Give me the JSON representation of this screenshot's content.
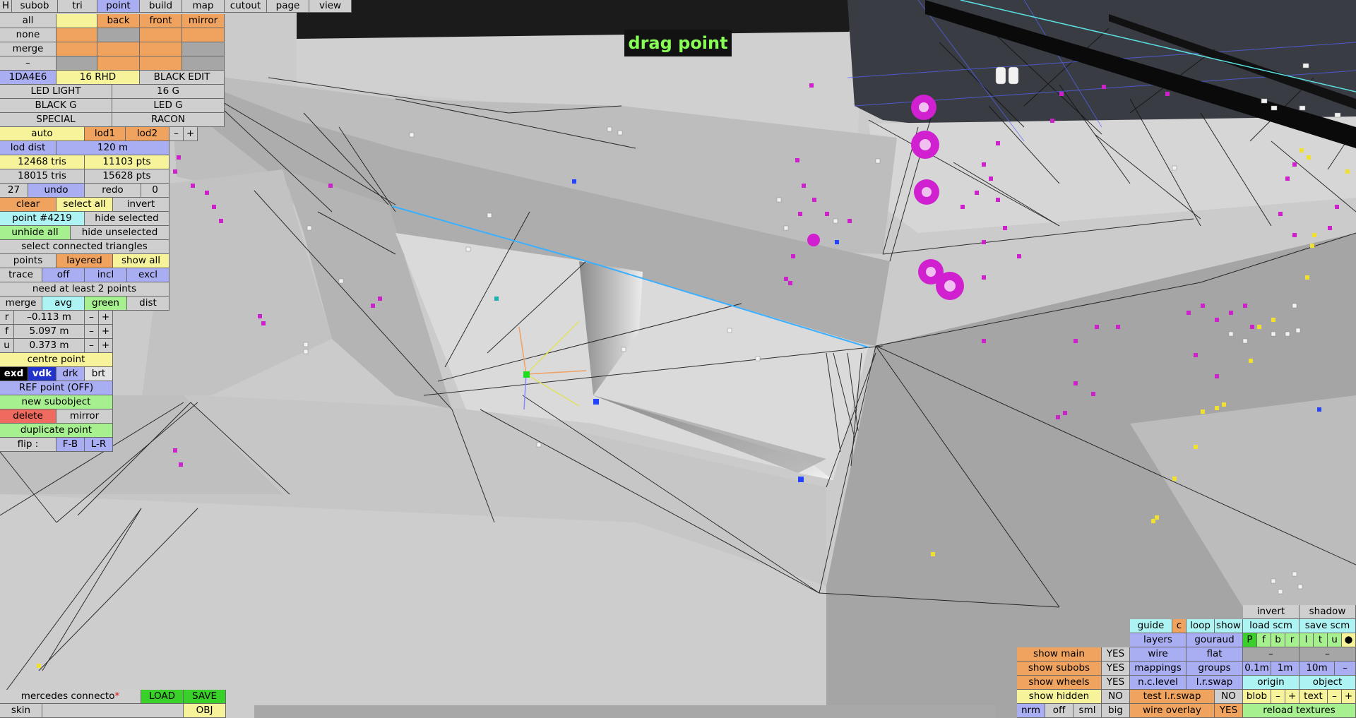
{
  "top_menu": [
    "H",
    "subob",
    "tri",
    "point",
    "build",
    "map",
    "cutout",
    "page",
    "view"
  ],
  "active_tab": "point",
  "overlay_label": "drag point",
  "selection_rows": {
    "all": {
      "label": "all",
      "cols": [
        "",
        "back",
        "front",
        "mirror"
      ]
    },
    "none": {
      "label": "none"
    },
    "merge": {
      "label": "merge"
    },
    "dash": {
      "label": "–"
    }
  },
  "variants": {
    "row1": [
      "1DA4E6",
      "16 RHD",
      "BLACK EDIT"
    ],
    "row2": [
      "LED LIGHT",
      "16 G"
    ],
    "row3": [
      "BLACK G",
      "LED G"
    ],
    "row4": [
      "SPECIAL",
      "RACON"
    ]
  },
  "lod": {
    "auto": "auto",
    "lod1": "lod1",
    "lod2": "lod2",
    "minus": "–",
    "plus": "+",
    "dist_label": "lod dist",
    "dist_value": "120 m",
    "tris1": "12468 tris",
    "pts1": "11103 pts",
    "tris2": "18015 tris",
    "pts2": "15628 pts"
  },
  "history": {
    "count": "27",
    "undo": "undo",
    "redo": "redo",
    "redo_count": "0"
  },
  "selection_tools": {
    "clear": "clear",
    "select_all": "select all",
    "invert": "invert",
    "point_id": "point #4219",
    "hide_selected": "hide selected",
    "unhide_all": "unhide all",
    "hide_unselected": "hide unselected",
    "select_connected": "select connected triangles",
    "points": "points",
    "layered": "layered",
    "show_all": "show all",
    "trace": "trace",
    "off": "off",
    "incl": "incl",
    "excl": "excl",
    "need_points": "need at least 2 points",
    "merge": "merge",
    "avg": "avg",
    "green": "green",
    "dist": "dist"
  },
  "coords": [
    {
      "axis": "r",
      "value": "–0.113 m",
      "minus": "–",
      "plus": "+"
    },
    {
      "axis": "f",
      "value": "5.097 m",
      "minus": "–",
      "plus": "+"
    },
    {
      "axis": "u",
      "value": "0.373 m",
      "minus": "–",
      "plus": "+"
    }
  ],
  "point_tools": {
    "centre_point": "centre point",
    "modes": [
      "exd",
      "vdk",
      "drk",
      "brt"
    ],
    "ref_point": "REF point (OFF)",
    "new_subobject": "new subobject",
    "delete": "delete",
    "mirror": "mirror",
    "duplicate_point": "duplicate point",
    "flip_label": "flip :",
    "flip_fb": "F-B",
    "flip_lr": "L-R"
  },
  "file": {
    "name": "mercedes connecto",
    "modified_mark": "*",
    "load": "LOAD",
    "save": "SAVE",
    "skin": "skin",
    "skin_value": "",
    "obj": "OBJ"
  },
  "bottom_right": {
    "invert": "invert",
    "shadow": "shadow",
    "guide": "guide",
    "c": "c",
    "loop": "loop",
    "show": "show",
    "load_scm": "load scm",
    "save_scm": "save scm",
    "layers": "layers",
    "gouraud": "gouraud",
    "letters": [
      "P",
      "f",
      "b",
      "r",
      "l",
      "t",
      "u",
      "●"
    ],
    "wire": "wire",
    "flat": "flat",
    "dash1": "–",
    "dash2": "–",
    "mappings": "mappings",
    "groups": "groups",
    "steps": [
      "0.1m",
      "1m",
      "10m",
      "–"
    ],
    "nc_level": "n.c.level",
    "lr_swap": "l.r.swap",
    "origin": "origin",
    "object": "object",
    "test_lr_swap": "test l.r.swap",
    "test_lr_value": "NO",
    "blob": "blob",
    "text": "text",
    "pm": [
      "–",
      "+"
    ],
    "wire_overlay": "wire overlay",
    "wire_overlay_value": "YES",
    "reload_textures": "reload textures",
    "sizes": [
      "nrm",
      "off",
      "sml",
      "big"
    ],
    "show_main": "show main",
    "show_main_value": "YES",
    "show_subobs": "show subobs",
    "show_subobs_value": "YES",
    "show_wheels": "show wheels",
    "show_wheels_value": "YES",
    "show_hidden": "show hidden",
    "show_hidden_value": "NO"
  }
}
